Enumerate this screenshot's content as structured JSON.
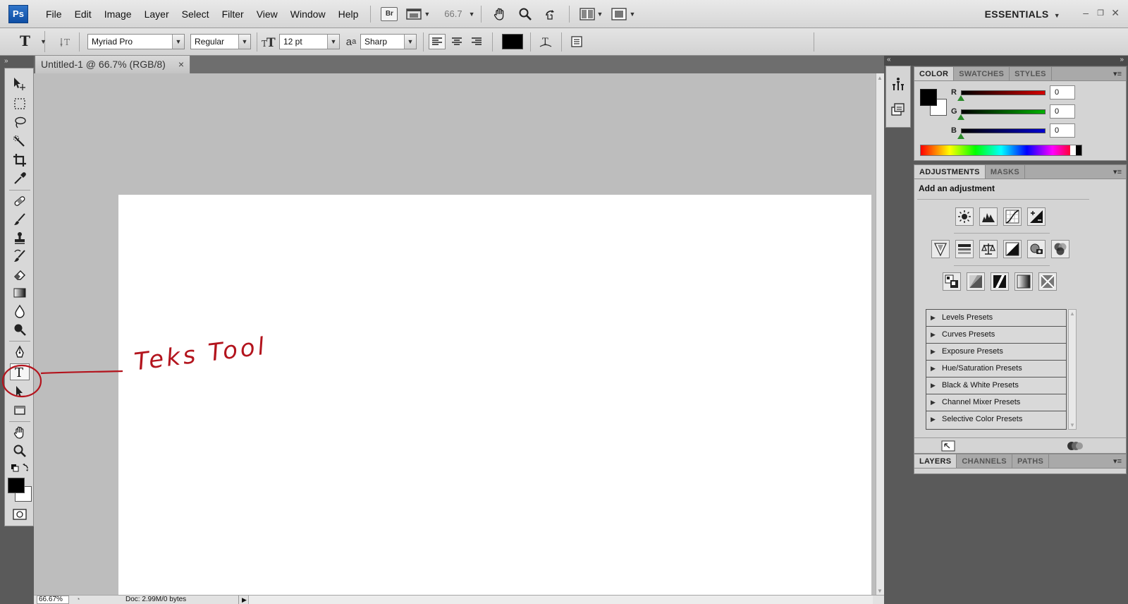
{
  "app": {
    "logo_text": "Ps",
    "menus": [
      "File",
      "Edit",
      "Image",
      "Layer",
      "Select",
      "Filter",
      "View",
      "Window",
      "Help"
    ],
    "bridge_label": "Br",
    "zoom_value": "66.7",
    "workspace": "ESSENTIALS"
  },
  "options_bar": {
    "font_family": "Myriad Pro",
    "font_style": "Regular",
    "font_size": "12 pt",
    "antialias_glyph": "a",
    "antialias_glyph_sub": "a",
    "antialias": "Sharp",
    "text_color": "#000000"
  },
  "document": {
    "tab_title": "Untitled-1 @ 66.7% (RGB/8)",
    "tab_close": "×",
    "status_zoom": "66.67%",
    "status_doc": "Doc: 2.99M/0 bytes"
  },
  "annotation": {
    "text": "Teks Tool",
    "color": "#b3141d"
  },
  "color_panel": {
    "tabs": [
      "COLOR",
      "SWATCHES",
      "STYLES"
    ],
    "foreground": "#000000",
    "background": "#ffffff",
    "channels": [
      {
        "label": "R",
        "value": "0",
        "gradient": "#d40000"
      },
      {
        "label": "G",
        "value": "0",
        "gradient": "#00b000"
      },
      {
        "label": "B",
        "value": "0",
        "gradient": "#0000d0"
      }
    ]
  },
  "adjustments_panel": {
    "tabs": [
      "ADJUSTMENTS",
      "MASKS"
    ],
    "heading": "Add an adjustment",
    "presets": [
      "Levels Presets",
      "Curves Presets",
      "Exposure Presets",
      "Hue/Saturation Presets",
      "Black & White Presets",
      "Channel Mixer Presets",
      "Selective Color Presets"
    ]
  },
  "layers_panel": {
    "tabs": [
      "LAYERS",
      "CHANNELS",
      "PATHS"
    ]
  },
  "icons": {
    "menubar": [
      "hand-icon",
      "zoom-icon",
      "rotate-view-icon",
      "arrange-documents-icon",
      "screen-mode-icon"
    ],
    "tools": [
      "move-icon",
      "marquee-icon",
      "lasso-icon",
      "quick-selection-icon",
      "crop-icon",
      "eyedropper-icon",
      "healing-brush-icon",
      "brush-icon",
      "clone-stamp-icon",
      "history-brush-icon",
      "eraser-icon",
      "gradient-icon",
      "blur-icon",
      "dodge-icon",
      "pen-icon",
      "type-icon",
      "path-selection-icon",
      "rectangle-icon",
      "hand-icon",
      "zoom-icon"
    ]
  }
}
